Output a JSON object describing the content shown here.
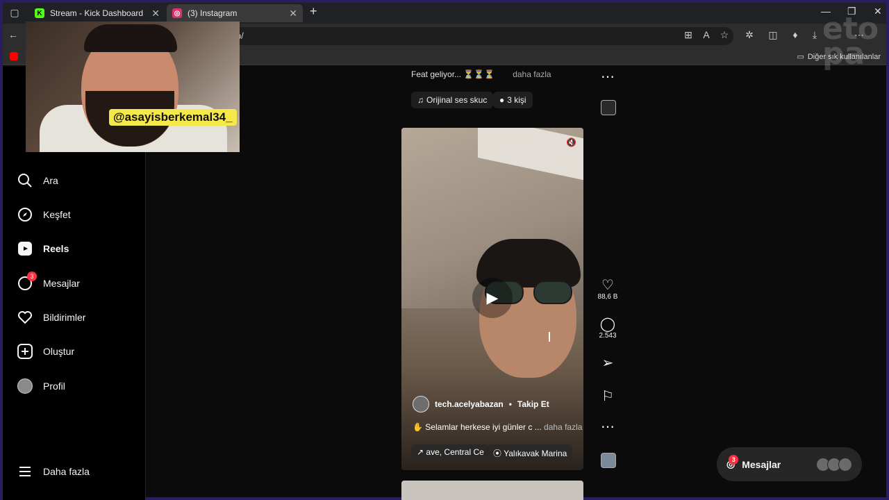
{
  "browser": {
    "tabs": [
      {
        "title": "Stream - Kick Dashboard",
        "icon": "kick-icon",
        "color": "#53fc18"
      },
      {
        "title": "(3) Instagram",
        "icon": "instagram-icon",
        "color": "#e1306c",
        "active": true
      }
    ],
    "url": "jt8Op/",
    "bookmarks_other": "Diğer sık kullanılanlar"
  },
  "webcam": {
    "handle": "@asayisberkemal34_"
  },
  "sidebar": {
    "items": [
      {
        "label": "Ara",
        "icon": "search-icon"
      },
      {
        "label": "Keşfet",
        "icon": "explore-icon"
      },
      {
        "label": "Reels",
        "icon": "reels-icon"
      },
      {
        "label": "Mesajlar",
        "icon": "messenger-icon",
        "badge": "3"
      },
      {
        "label": "Bildirimler",
        "icon": "heart-icon"
      },
      {
        "label": "Oluştur",
        "icon": "plus-icon"
      },
      {
        "label": "Profil",
        "icon": "avatar"
      },
      {
        "label": "Daha fazla",
        "icon": "menu-icon"
      }
    ]
  },
  "reel_prev": {
    "caption": "Feat geliyor... ⏳⏳⏳",
    "more": "daha fazla",
    "audio": "Orijinal ses  skuc",
    "people": "3 kişi"
  },
  "reel": {
    "author": "tech.acelyabazan",
    "follow": "Takip Et",
    "caption": "Selamlar herkese iyi günler c ...",
    "more": "daha fazla",
    "audio": "ave, Central Ce",
    "location": "Yalıkavak Marina",
    "likes": "88,6 B",
    "comments": "2.543"
  },
  "dock": {
    "label": "Mesajlar",
    "badge": "3"
  }
}
